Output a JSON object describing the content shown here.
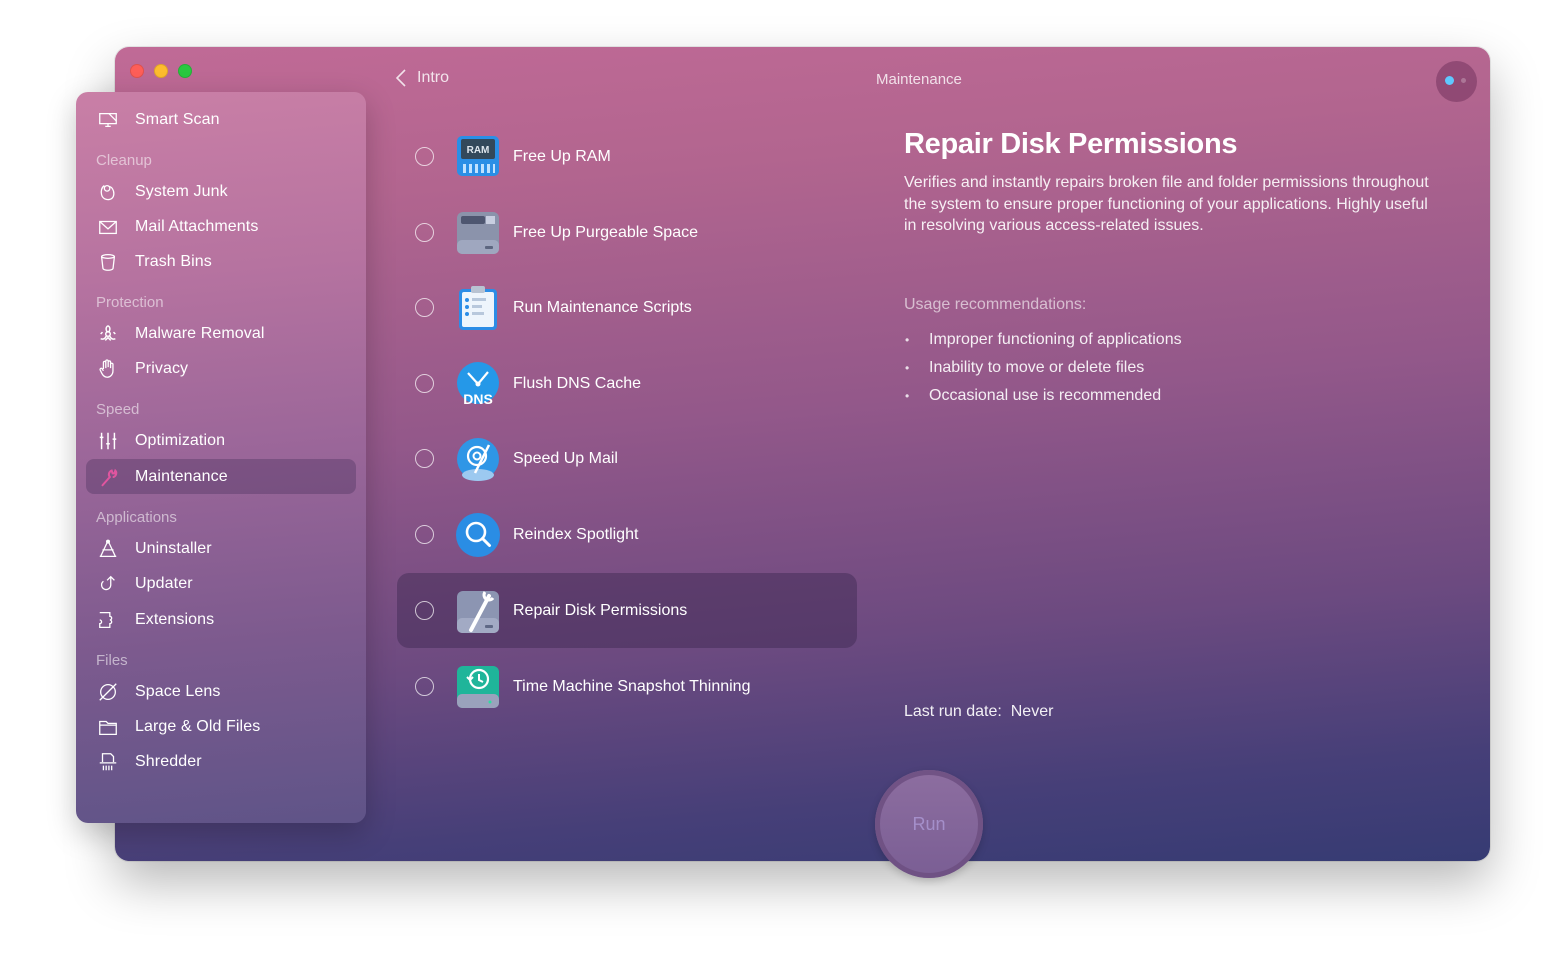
{
  "window": {
    "traffic_lights": [
      "close",
      "minimize",
      "maximize"
    ]
  },
  "sidebar": {
    "top_item": {
      "label": "Smart Scan",
      "icon": "smart-scan-icon"
    },
    "sections": [
      {
        "title": "Cleanup",
        "items": [
          {
            "label": "System Junk",
            "icon": "system-junk-icon"
          },
          {
            "label": "Mail Attachments",
            "icon": "envelope-icon"
          },
          {
            "label": "Trash Bins",
            "icon": "trash-icon"
          }
        ]
      },
      {
        "title": "Protection",
        "items": [
          {
            "label": "Malware Removal",
            "icon": "biohazard-icon"
          },
          {
            "label": "Privacy",
            "icon": "hand-icon"
          }
        ]
      },
      {
        "title": "Speed",
        "items": [
          {
            "label": "Optimization",
            "icon": "sliders-icon"
          },
          {
            "label": "Maintenance",
            "icon": "wrench-icon",
            "active": true
          }
        ]
      },
      {
        "title": "Applications",
        "items": [
          {
            "label": "Uninstaller",
            "icon": "uninstaller-icon"
          },
          {
            "label": "Updater",
            "icon": "updater-arrow-icon"
          },
          {
            "label": "Extensions",
            "icon": "puzzle-icon"
          }
        ]
      },
      {
        "title": "Files",
        "items": [
          {
            "label": "Space Lens",
            "icon": "planet-icon"
          },
          {
            "label": "Large & Old Files",
            "icon": "folder-icon"
          },
          {
            "label": "Shredder",
            "icon": "shredder-icon"
          }
        ]
      }
    ]
  },
  "header": {
    "back_label": "Intro",
    "title": "Maintenance"
  },
  "tasks": [
    {
      "label": "Free Up RAM",
      "icon": "ram-icon",
      "checked": false
    },
    {
      "label": "Free Up Purgeable Space",
      "icon": "drive-icon",
      "checked": false
    },
    {
      "label": "Run Maintenance Scripts",
      "icon": "clipboard-icon",
      "checked": false
    },
    {
      "label": "Flush DNS Cache",
      "icon": "dns-icon",
      "checked": false
    },
    {
      "label": "Speed Up Mail",
      "icon": "mail-speed-icon",
      "checked": false
    },
    {
      "label": "Reindex Spotlight",
      "icon": "spotlight-icon",
      "checked": false
    },
    {
      "label": "Repair Disk Permissions",
      "icon": "disk-repair-icon",
      "checked": false,
      "selected": true
    },
    {
      "label": "Time Machine Snapshot Thinning",
      "icon": "time-machine-icon",
      "checked": false
    }
  ],
  "detail": {
    "title": "Repair Disk Permissions",
    "description": "Verifies and instantly repairs broken file and folder permissions throughout the system to ensure proper functioning of your applications. Highly useful in resolving various access-related issues.",
    "usage_title": "Usage recommendations:",
    "usage_items": [
      "Improper functioning of applications",
      "Inability to move or delete files",
      "Occasional use is recommended"
    ],
    "last_run_label": "Last run date:",
    "last_run_value": "Never"
  },
  "run_button": {
    "label": "Run",
    "enabled": false
  },
  "colors": {
    "accent_wrench": "#e0559f",
    "assistant_dot": "#5fc8ff",
    "traffic_close": "#fe5e58",
    "traffic_min": "#fdbc2e",
    "traffic_max": "#29c840"
  }
}
